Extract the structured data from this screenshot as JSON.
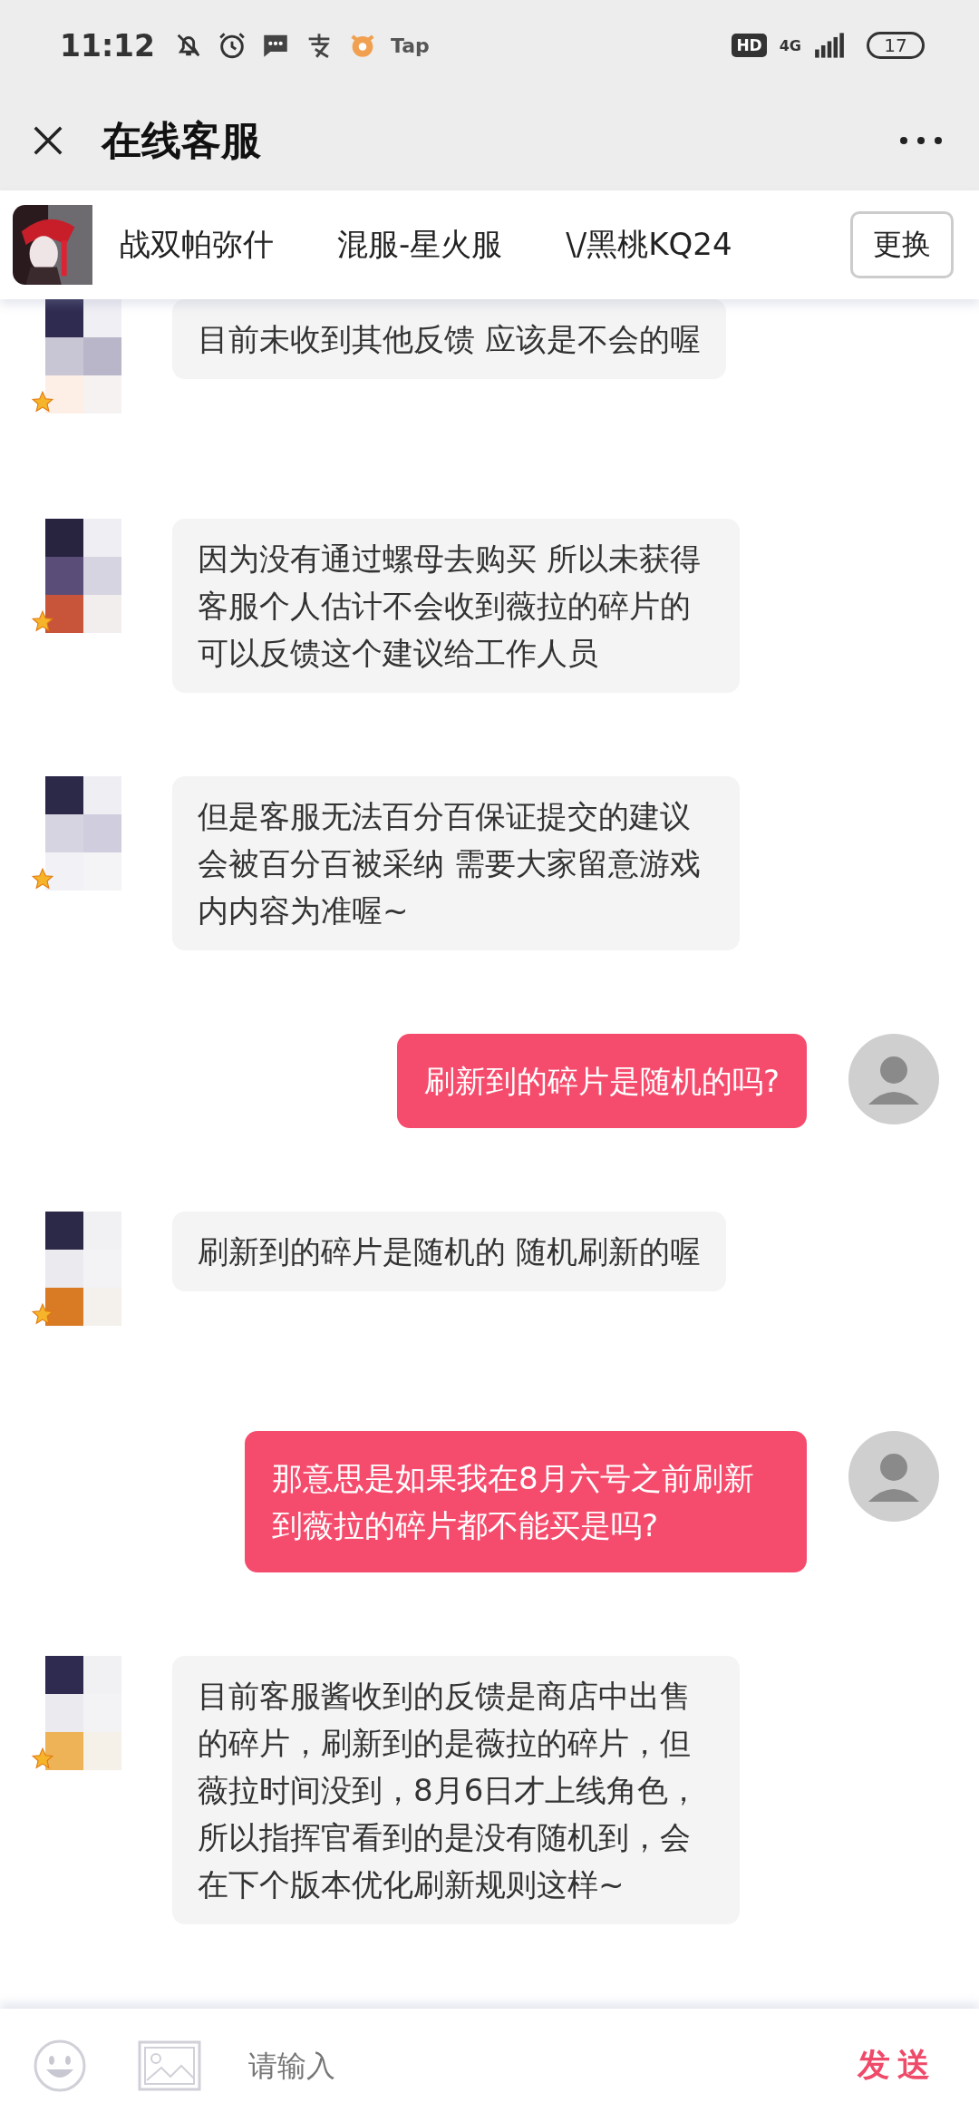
{
  "status_bar": {
    "time": "11:12",
    "app_label": "Tap",
    "network_badge": "HD",
    "network_type": "4G",
    "battery": "17"
  },
  "header": {
    "title": "在线客服"
  },
  "game_bar": {
    "game": "战双帕弥什",
    "server": "混服-星火服",
    "role": "\\/黑桃KQ24",
    "button": "更换"
  },
  "messages": [
    {
      "kind": "agent",
      "text": "目前未收到其他反馈  应该是不会的喔"
    },
    {
      "kind": "agent",
      "text": "因为没有通过螺母去购买 所以未获得客服个人估计不会收到薇拉的碎片的可以反馈这个建议给工作人员"
    },
    {
      "kind": "agent",
      "text": "但是客服无法百分百保证提交的建议会被百分百被采纳 需要大家留意游戏内内容为准喔~"
    },
    {
      "kind": "user",
      "text": "刷新到的碎片是随机的吗?"
    },
    {
      "kind": "agent",
      "text": "刷新到的碎片是随机的 随机刷新的喔"
    },
    {
      "kind": "user",
      "text": "那意思是如果我在8月六号之前刷新到薇拉的碎片都不能买是吗?"
    },
    {
      "kind": "agent",
      "text": "目前客服酱收到的反馈是商店中出售的碎片，刷新到的是薇拉的碎片，但薇拉时间没到，8月6日才上线角色，所以指挥官看到的是没有随机到，会在下个版本优化刷新规则这样~"
    }
  ],
  "input_bar": {
    "placeholder": "请输入",
    "send": "发送"
  }
}
